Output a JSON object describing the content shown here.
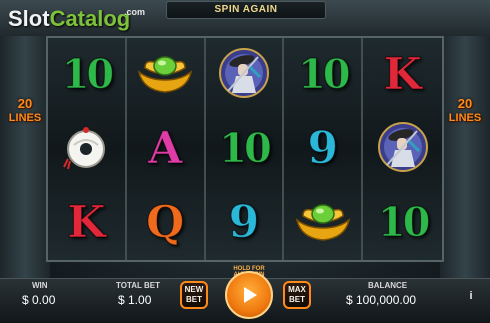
{
  "watermark": {
    "slot": "Slot",
    "catalog": "Catalog",
    "com": ".com"
  },
  "banner": "SPIN AGAIN",
  "lines": {
    "count": "20",
    "word": "LINES"
  },
  "reels": [
    [
      {
        "kind": "letter",
        "text": "10",
        "color": "green"
      },
      {
        "kind": "icon",
        "icon": "jade-coin-icon"
      },
      {
        "kind": "letter",
        "text": "K",
        "color": "red"
      }
    ],
    [
      {
        "kind": "icon",
        "icon": "gold-ingot-icon"
      },
      {
        "kind": "letter",
        "text": "A",
        "color": "pink"
      },
      {
        "kind": "letter",
        "text": "Q",
        "color": "orange"
      }
    ],
    [
      {
        "kind": "icon",
        "icon": "warrior-icon"
      },
      {
        "kind": "letter",
        "text": "10",
        "color": "green"
      },
      {
        "kind": "letter",
        "text": "9",
        "color": "cyan"
      }
    ],
    [
      {
        "kind": "letter",
        "text": "10",
        "color": "green"
      },
      {
        "kind": "letter",
        "text": "9",
        "color": "cyan"
      },
      {
        "kind": "icon",
        "icon": "gold-ingot-icon"
      }
    ],
    [
      {
        "kind": "letter",
        "text": "K",
        "color": "red"
      },
      {
        "kind": "icon",
        "icon": "warrior-icon"
      },
      {
        "kind": "letter",
        "text": "10",
        "color": "green"
      }
    ]
  ],
  "footer": {
    "win_label": "WIN",
    "win_value": "$ 0.00",
    "total_bet_label": "TOTAL BET",
    "total_bet_value": "$ 1.00",
    "new_bet_label": "NEW BET",
    "spin_caption": "HOLD FOR AUTOSPIN",
    "max_bet_label": "MAX BET",
    "balance_label": "BALANCE",
    "balance_value": "$ 100,000.00",
    "info_label": "i"
  },
  "colors": {
    "accent": "#ff8a1a",
    "green": "#2fb84a",
    "red": "#e0283a",
    "pink": "#e03ca8",
    "cyan": "#2bb8d8",
    "orange": "#f06a1e"
  }
}
